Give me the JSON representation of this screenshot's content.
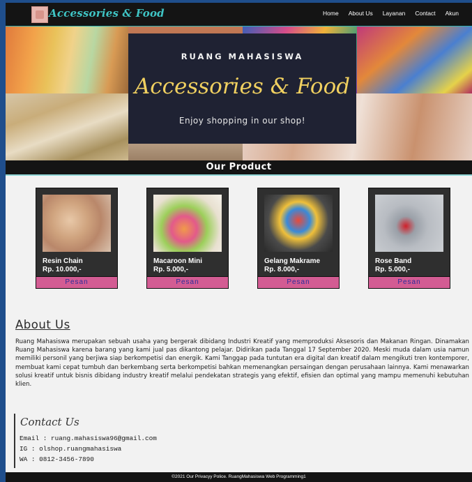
{
  "nav": {
    "brand": "Accessories & Food",
    "links": [
      "Home",
      "About Us",
      "Layanan",
      "Contact",
      "Akun"
    ]
  },
  "hero": {
    "tagline": "RUANG MAHASISWA",
    "title": "Accessories & Food",
    "subtitle": "Enjoy shopping in our shop!"
  },
  "products": {
    "heading": "Our Product",
    "items": [
      {
        "name": "Resin Chain",
        "price": "Rp. 10.000,-",
        "button": "Pesan"
      },
      {
        "name": "Macaroon Mini",
        "price": "Rp. 5.000,-",
        "button": "Pesan"
      },
      {
        "name": "Gelang Makrame",
        "price": "Rp. 8.000,-",
        "button": "Pesan"
      },
      {
        "name": "Rose Band",
        "price": "Rp. 5.000,-",
        "button": "Pesan"
      }
    ]
  },
  "about": {
    "title": "About Us",
    "text": "Ruang Mahasiswa merupakan sebuah usaha yang bergerak dibidang Industri Kreatif yang memproduksi Aksesoris dan Makanan Ringan. Dinamakan Ruang Mahasiswa karena barang yang kami jual pas dikantong pelajar. Didirikan pada Tanggal 17 September 2020. Meski muda dalam usia namun memiliki personil yang berjiwa siap berkompetisi dan energik. Kami Tanggap pada tuntutan era digital dan kreatif dalam mengikuti tren kontemporer, membuat kami cepat tumbuh dan berkembang serta berkompetisi bahkan memenangkan persaingan dengan perusahaan lainnya. Kami menawarkan solusi kreatif untuk bisnis dibidang industry kreatif melalui pendekatan strategis yang efektif, efisien dan optimal yang mampu memenuhi kebutuhan klien."
  },
  "contact": {
    "title": "Contact Us",
    "email": "Email : ruang.mahasiswa96@gmail.com",
    "ig": "IG : olshop.ruangmahasiswa",
    "wa": "WA : 0812-3456-7890"
  },
  "footer": {
    "text": "©2021 Our Privacyy Police. RuangMahasiswa Web Programming1"
  }
}
